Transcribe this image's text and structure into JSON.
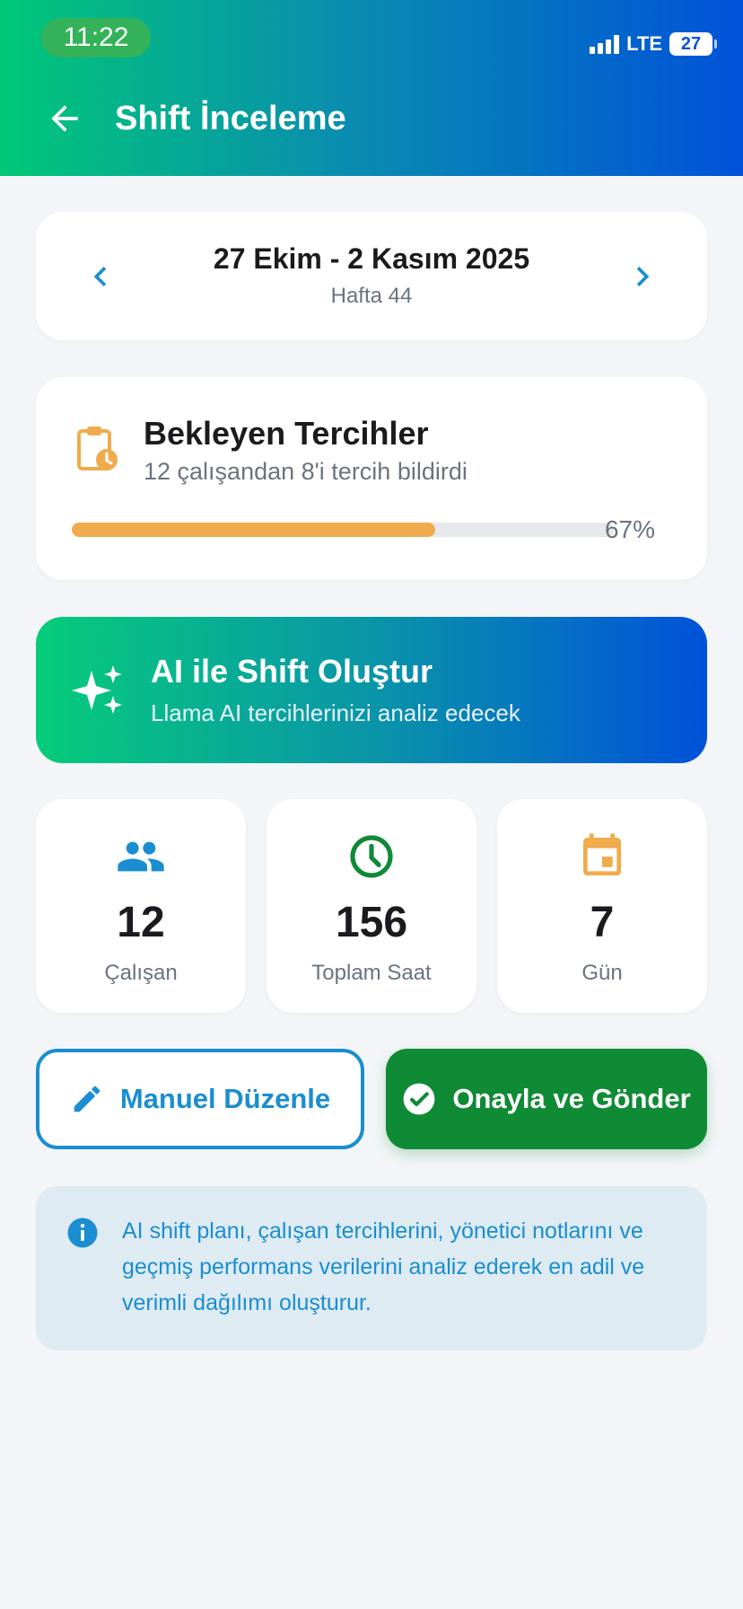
{
  "status_bar": {
    "time": "11:22",
    "network": "LTE",
    "battery": "27"
  },
  "header": {
    "title": "Shift İnceleme"
  },
  "week": {
    "range": "27 Ekim - 2 Kasım 2025",
    "label": "Hafta 44"
  },
  "preferences": {
    "title": "Bekleyen Tercihler",
    "subtitle": "12 çalışandan 8'i tercih bildirdi",
    "progress_percent": 67,
    "progress_label": "67%",
    "progress_color": "#f0ab4c"
  },
  "ai_card": {
    "title": "AI ile Shift Oluştur",
    "subtitle": "Llama AI tercihlerinizi analiz edecek"
  },
  "stats": [
    {
      "value": "12",
      "label": "Çalışan",
      "icon": "people-icon",
      "color": "#1a8ed0"
    },
    {
      "value": "156",
      "label": "Toplam Saat",
      "icon": "clock-icon",
      "color": "#0f8a35"
    },
    {
      "value": "7",
      "label": "Gün",
      "icon": "calendar-icon",
      "color": "#f0ab4c"
    }
  ],
  "actions": {
    "manual": "Manuel Düzenle",
    "approve": "Onayla ve Gönder"
  },
  "info": {
    "text": "AI shift planı, çalışan tercihlerini, yönetici notlarını ve geçmiş performans verilerini analiz ederek en adil ve verimli dağılımı oluşturur."
  }
}
